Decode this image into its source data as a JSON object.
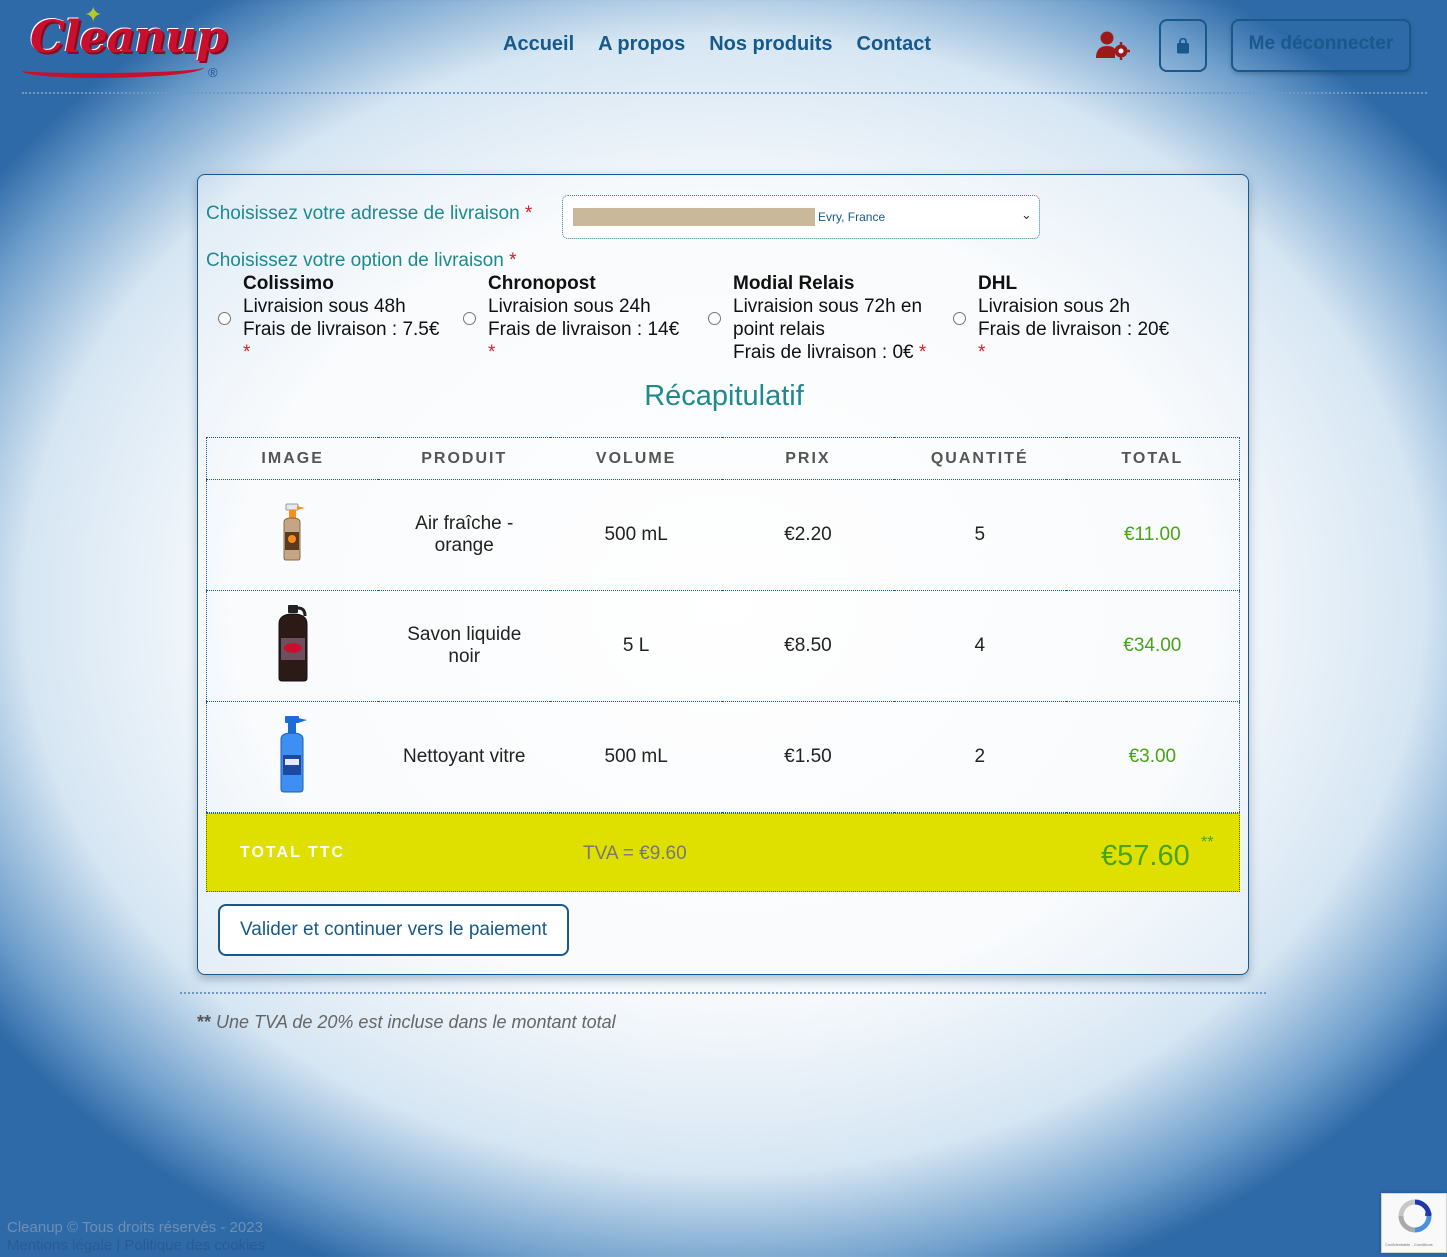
{
  "brand": {
    "logo_text": "Cleanup",
    "registered_mark": "®"
  },
  "nav": {
    "items": [
      {
        "label": "Accueil"
      },
      {
        "label": "A propos"
      },
      {
        "label": "Nos produits"
      },
      {
        "label": "Contact"
      }
    ]
  },
  "header": {
    "logout_label": "Me déconnecter"
  },
  "address": {
    "label": "Choisissez votre adresse de livraison",
    "required_mark": "*",
    "selected_city": "Evry, France"
  },
  "shipping": {
    "label": "Choisissez votre option de livraison",
    "required_mark": "*",
    "options": [
      {
        "name": "Colissimo",
        "line1": "Livraision sous 48h",
        "line2": "Frais de livraison : 7.5€",
        "required_mark": "*"
      },
      {
        "name": "Chronopost",
        "line1": "Livraision sous 24h",
        "line2": "Frais de livraison : 14€",
        "required_mark": "*"
      },
      {
        "name": "Modial Relais",
        "line1": "Livraision sous 72h en point relais",
        "line2": "Frais de livraison : 0€",
        "required_mark": "*"
      },
      {
        "name": "DHL",
        "line1": "Livraision sous 2h",
        "line2": "Frais de livraison : 20€",
        "required_mark": "*"
      }
    ]
  },
  "recap": {
    "title": "Récapitulatif",
    "headers": [
      "IMAGE",
      "PRODUIT",
      "VOLUME",
      "PRIX",
      "QUANTITÉ",
      "TOTAL"
    ],
    "rows": [
      {
        "product": "Air fraîche - orange",
        "volume": "500 mL",
        "price": "€2.20",
        "quantity": "5",
        "total": "€11.00"
      },
      {
        "product": "Savon liquide noir",
        "volume": "5 L",
        "price": "€8.50",
        "quantity": "4",
        "total": "€34.00"
      },
      {
        "product": "Nettoyant vitre",
        "volume": "500 mL",
        "price": "€1.50",
        "quantity": "2",
        "total": "€3.00"
      }
    ],
    "total_label": "TOTAL TTC",
    "tva": "TVA = €9.60",
    "grand_total": "€57.60",
    "grand_total_mark": "**"
  },
  "actions": {
    "validate_label": "Valider et continuer vers le paiement"
  },
  "note": {
    "stars": "**",
    "text": " Une TVA de 20% est incluse dans le montant total"
  },
  "footer": {
    "copyright": "Cleanup © Tous droits réservés - 2023",
    "legal_link": "Mentions légale",
    "separator": " | ",
    "cookies_link": "Politique des cookies"
  },
  "recaptcha": {
    "small_text": "Confidentialité - Conditions"
  },
  "colors": {
    "primary": "#17598a",
    "teal": "#1e8a8e",
    "total_bg": "#dfe000",
    "green": "#4aa317",
    "required": "#d62020"
  }
}
